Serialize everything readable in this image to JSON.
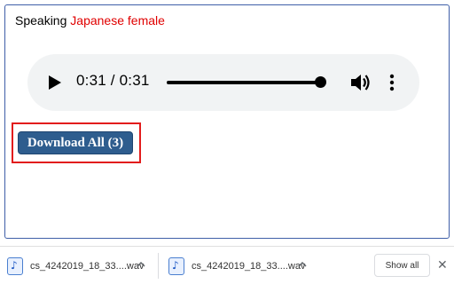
{
  "speaking": {
    "prefix": "Speaking",
    "voice": "Japanese female"
  },
  "player": {
    "time_display": "0:31 / 0:31",
    "progress_fraction": 1.0
  },
  "download_all": {
    "label": "Download All (3)"
  },
  "colors": {
    "accent_red": "#e00000",
    "button_blue": "#2e5d8e",
    "panel_border": "#3f5fa8"
  },
  "shelf": {
    "items": [
      {
        "filename": "cs_4242019_18_33....wav",
        "icon": "audio-file-icon"
      },
      {
        "filename": "cs_4242019_18_33....wav",
        "icon": "audio-file-icon"
      }
    ],
    "show_all_label": "Show all",
    "close_symbol": "✕"
  }
}
